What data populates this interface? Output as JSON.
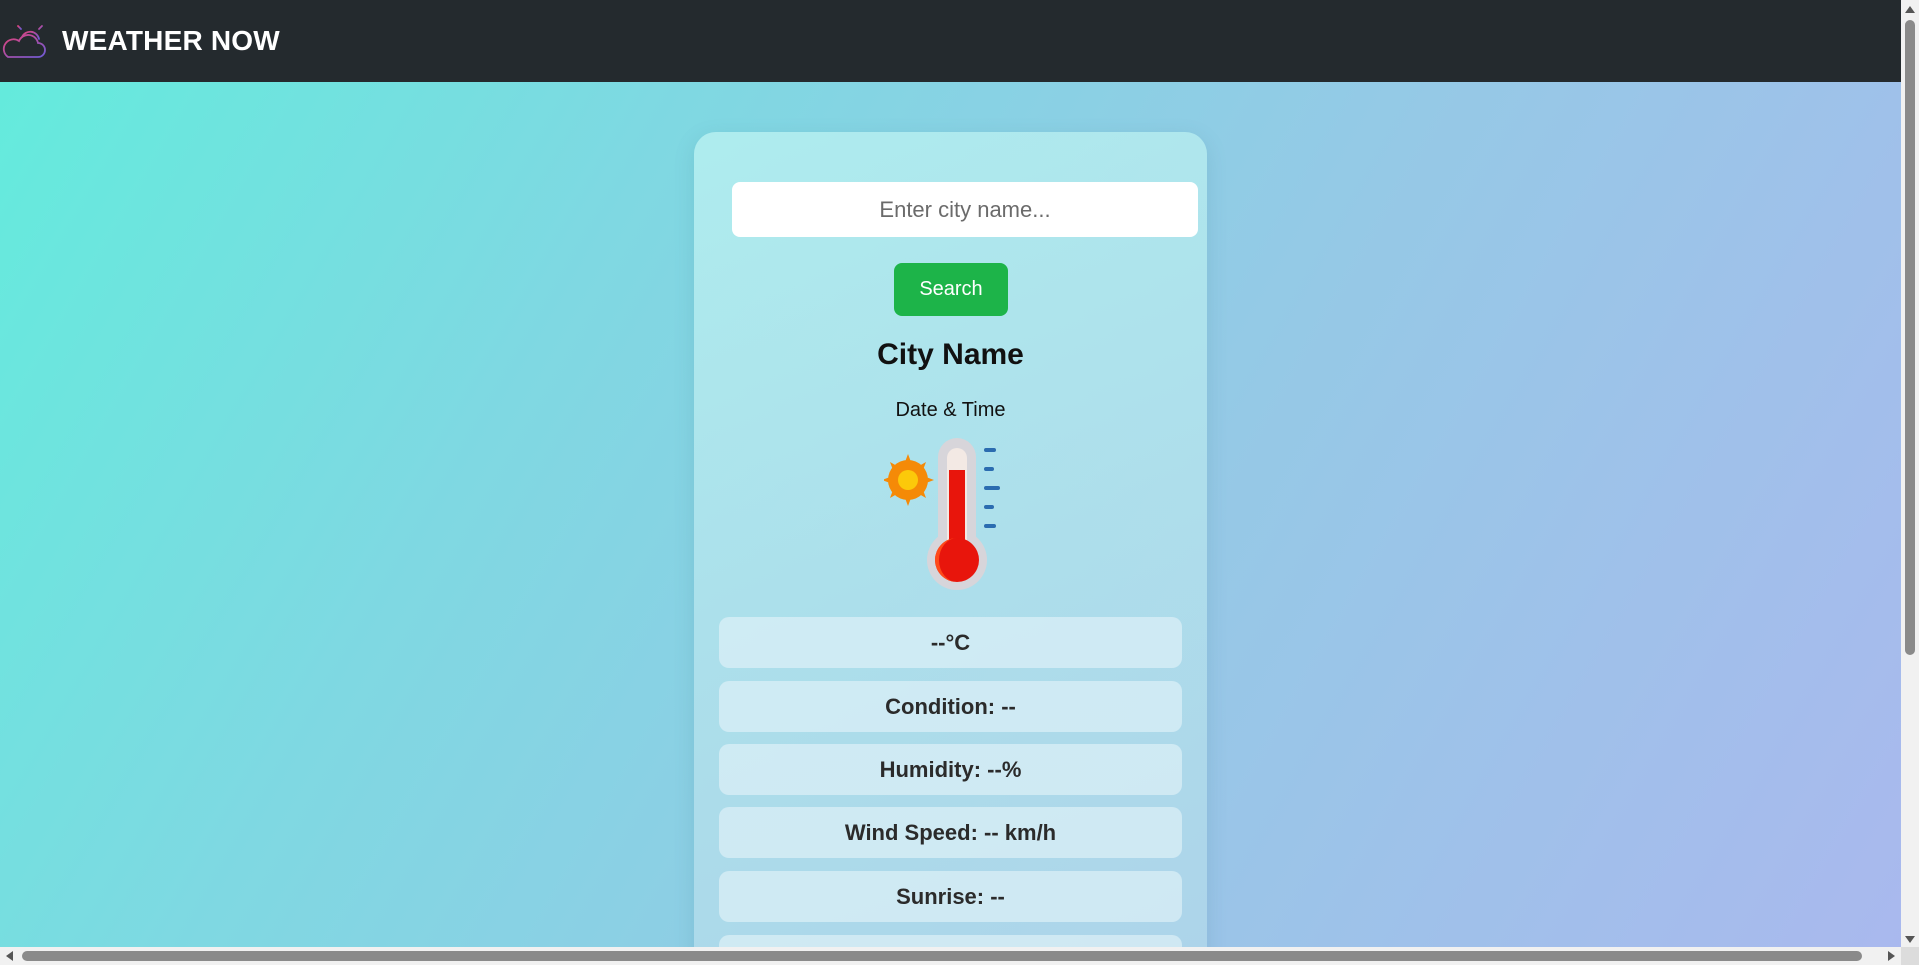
{
  "navbar": {
    "brand": "WEATHER NOW",
    "logo_icon": "cloud-sun-icon"
  },
  "search": {
    "placeholder": "Enter city name...",
    "value": "",
    "button_label": "Search"
  },
  "weather": {
    "city": "City Name",
    "datetime": "Date & Time",
    "icon": "thermometer-sun-icon",
    "temperature": "--°C",
    "condition": "Condition: --",
    "humidity": "Humidity: --%",
    "wind_speed": "Wind Speed: -- km/h",
    "sunrise": "Sunrise: --"
  },
  "colors": {
    "navbar_bg": "#242a2e",
    "search_button": "#1db449",
    "thermometer_red": "#e8150c",
    "sun_orange": "#f58a07",
    "tick_blue": "#2b6cb0"
  }
}
